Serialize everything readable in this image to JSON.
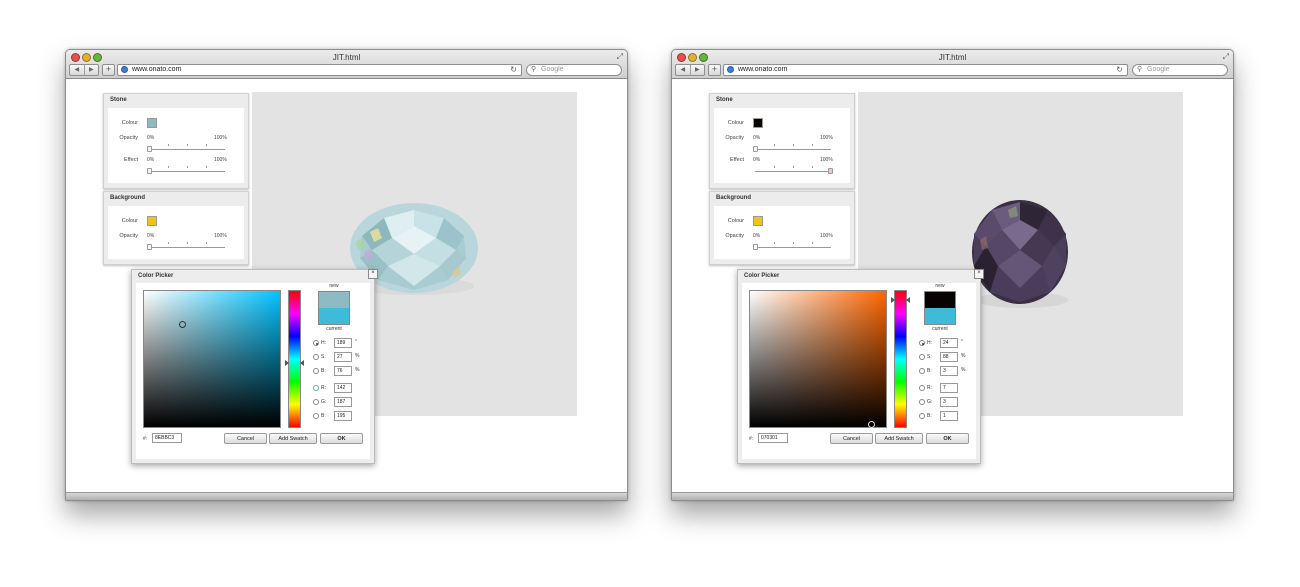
{
  "windows": [
    {
      "title": "JIT.html",
      "url": "www.onato.com",
      "search_placeholder": "Google",
      "stone": {
        "title": "Stone",
        "colour_label": "Colour",
        "colour": "#8ebbc3",
        "opacity_label": "Opacity",
        "opacity_min": "0%",
        "opacity_max": "100%",
        "opacity_value": 0,
        "effect_label": "Effect",
        "effect_min": "0%",
        "effect_max": "100%",
        "effect_value": 0
      },
      "background": {
        "title": "Background",
        "colour_label": "Colour",
        "colour": "#f2c316",
        "opacity_label": "Opacity",
        "opacity_min": "0%",
        "opacity_max": "100%",
        "opacity_value": 0
      },
      "picker": {
        "title": "Color Picker",
        "close": "×",
        "new_label": "new",
        "current_label": "current",
        "new_color": "#8ebbc3",
        "current_color": "#3dbbd9",
        "hue_color": "#00c3ff",
        "fields": [
          {
            "label": "H:",
            "value": "189",
            "unit": "°",
            "selected": true
          },
          {
            "label": "S:",
            "value": "27",
            "unit": "%",
            "selected": false
          },
          {
            "label": "B:",
            "value": "76",
            "unit": "%",
            "selected": false
          },
          {
            "label": "R:",
            "value": "142",
            "unit": "",
            "selected": false
          },
          {
            "label": "G:",
            "value": "187",
            "unit": "",
            "selected": false
          },
          {
            "label": "B:",
            "value": "195",
            "unit": "",
            "selected": false
          }
        ],
        "hex_label": "#:",
        "hex": "8EBBC3",
        "cancel": "Cancel",
        "add_swatch": "Add Swatch",
        "ok": "OK"
      }
    },
    {
      "title": "JIT.html",
      "url": "www.onato.com",
      "search_placeholder": "Google",
      "stone": {
        "title": "Stone",
        "colour_label": "Colour",
        "colour": "#070301",
        "opacity_label": "Opacity",
        "opacity_min": "0%",
        "opacity_max": "100%",
        "opacity_value": 0,
        "effect_label": "Effect",
        "effect_min": "0%",
        "effect_max": "100%",
        "effect_value": 100
      },
      "background": {
        "title": "Background",
        "colour_label": "Colour",
        "colour": "#f2c316",
        "opacity_label": "Opacity",
        "opacity_min": "0%",
        "opacity_max": "100%",
        "opacity_value": 0
      },
      "picker": {
        "title": "Color Picker",
        "close": "×",
        "new_label": "new",
        "current_label": "current",
        "new_color": "#070301",
        "current_color": "#3dbbd9",
        "hue_color": "#ff6600",
        "fields": [
          {
            "label": "H:",
            "value": "24",
            "unit": "°",
            "selected": true
          },
          {
            "label": "S:",
            "value": "88",
            "unit": "%",
            "selected": false
          },
          {
            "label": "B:",
            "value": "3",
            "unit": "%",
            "selected": false
          },
          {
            "label": "R:",
            "value": "7",
            "unit": "",
            "selected": false
          },
          {
            "label": "G:",
            "value": "3",
            "unit": "",
            "selected": false
          },
          {
            "label": "B:",
            "value": "1",
            "unit": "",
            "selected": false
          }
        ],
        "hex_label": "#:",
        "hex": "070301",
        "cancel": "Cancel",
        "add_swatch": "Add Swatch",
        "ok": "OK"
      }
    }
  ]
}
